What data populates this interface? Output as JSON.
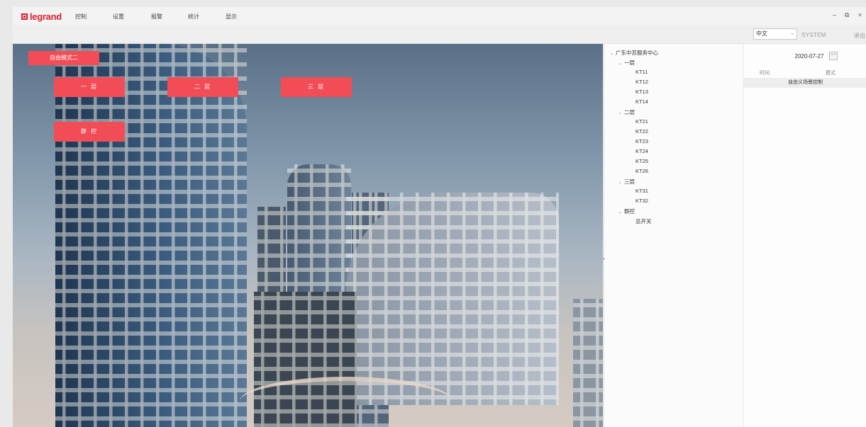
{
  "app": {
    "logo_text": "legrand",
    "menu": [
      "控制",
      "设置",
      "报警",
      "统计",
      "显示"
    ],
    "window_controls": [
      "–",
      "⧉",
      "×"
    ]
  },
  "toolbar": {
    "language": "中文",
    "user": "SYSTEM",
    "logout": "退出"
  },
  "scene": {
    "mode_button": "自由模式二",
    "buttons": [
      "一 层",
      "二 层",
      "三 层",
      "群 控"
    ]
  },
  "tree": {
    "root": "广东中苏服务中心",
    "groups": [
      {
        "label": "一层",
        "items": [
          "KT11",
          "KT12",
          "KT13",
          "KT14"
        ]
      },
      {
        "label": "二层",
        "items": [
          "KT21",
          "KT22",
          "KT23",
          "KT24",
          "KT25",
          "KT26"
        ]
      },
      {
        "label": "三层",
        "items": [
          "KT31",
          "KT32"
        ]
      },
      {
        "label": "群控",
        "items": [
          "总开关"
        ]
      }
    ]
  },
  "log": {
    "date": "2020-07-27",
    "col_time": "时间",
    "col_mode": "模式",
    "rows": [
      "自由义场景控制"
    ]
  },
  "colors": {
    "accent": "#f24c57",
    "brand": "#e01e2d"
  }
}
